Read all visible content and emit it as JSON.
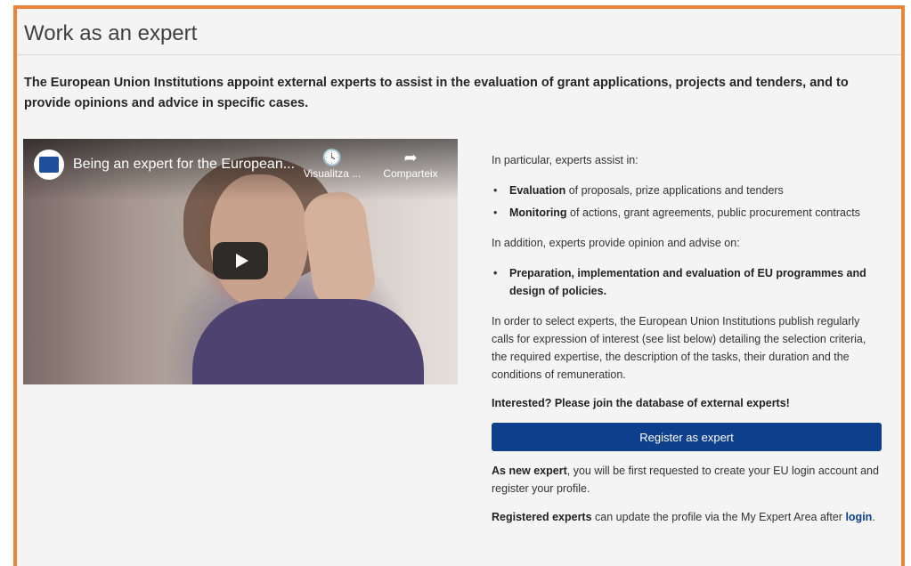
{
  "page": {
    "title": "Work as an expert",
    "intro": "The European Union Institutions appoint external experts to assist in the evaluation of grant applications, projects and tenders, and to provide opinions and advice in specific cases."
  },
  "video": {
    "title": "Being an expert for the European...",
    "watch_later_label": "Visualitza ...",
    "share_label": "Comparteix",
    "icons": [
      "clock-icon",
      "share-arrow-icon",
      "play-icon"
    ]
  },
  "details": {
    "assist_intro": "In particular, experts assist in:",
    "assist_items": [
      {
        "bold": "Evaluation",
        "rest": " of proposals, prize applications and tenders"
      },
      {
        "bold": "Monitoring",
        "rest": " of actions, grant agreements, public procurement contracts"
      }
    ],
    "opinion_intro": "In addition, experts provide opinion and advise on:",
    "opinion_item": "Preparation, implementation and evaluation of EU programmes and design of policies.",
    "selection_text": "In order to select experts, the European Union Institutions publish regularly calls for expression of interest (see list below) detailing the selection criteria, the required expertise, the description of the tasks, their duration and the conditions of remuneration.",
    "interested": "Interested? Please join the database of external experts!",
    "register_button": "Register as expert",
    "new_expert_bold": "As new expert",
    "new_expert_rest": ", you will be first requested to create your EU login account and register your profile.",
    "registered_bold": "Registered experts",
    "registered_rest": " can update the profile via the My Expert Area after ",
    "login_link": "login",
    "registered_end": "."
  },
  "colors": {
    "frame_border": "#e8853a",
    "button_bg": "#0e3f8c",
    "link": "#0e3f8c"
  }
}
